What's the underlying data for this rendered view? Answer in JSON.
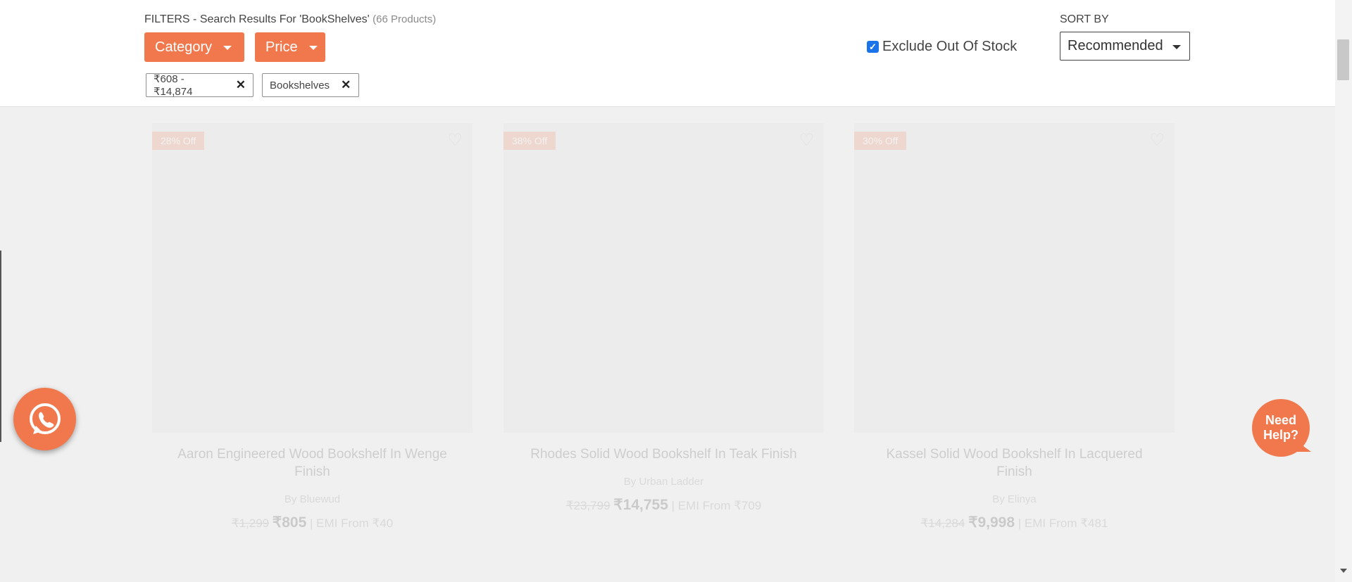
{
  "filters": {
    "title": "FILTERS - Search Results For 'BookShelves'",
    "count": "(66 Products)",
    "category_label": "Category",
    "price_label": "Price",
    "chips": [
      {
        "label": "₹608 - ₹14,874"
      },
      {
        "label": "Bookshelves"
      }
    ],
    "exclude_out_of_stock": {
      "label": "Exclude Out Of Stock",
      "checked": true
    }
  },
  "sort": {
    "label": "SORT BY",
    "selected": "Recommended"
  },
  "products": [
    {
      "badge": "28% Off",
      "name": "Aaron Engineered Wood Bookshelf In Wenge Finish",
      "brand": "By Bluewud",
      "old_price": "₹1,299",
      "price": "₹805",
      "emi": "| EMI From ₹40"
    },
    {
      "badge": "38% Off",
      "name": "Rhodes Solid Wood Bookshelf In Teak Finish",
      "brand": "By Urban Ladder",
      "old_price": "₹23,799",
      "price": "₹14,755",
      "emi": "| EMI From ₹709"
    },
    {
      "badge": "30% Off",
      "name": "Kassel Solid Wood Bookshelf In Lacquered Finish",
      "brand": "By Elinya",
      "old_price": "₹14,284",
      "price": "₹9,998",
      "emi": "| EMI From ₹481"
    }
  ],
  "help_widget": {
    "label": "Need Help?"
  },
  "colors": {
    "accent": "#f0784c",
    "checkbox": "#1a73e8"
  }
}
